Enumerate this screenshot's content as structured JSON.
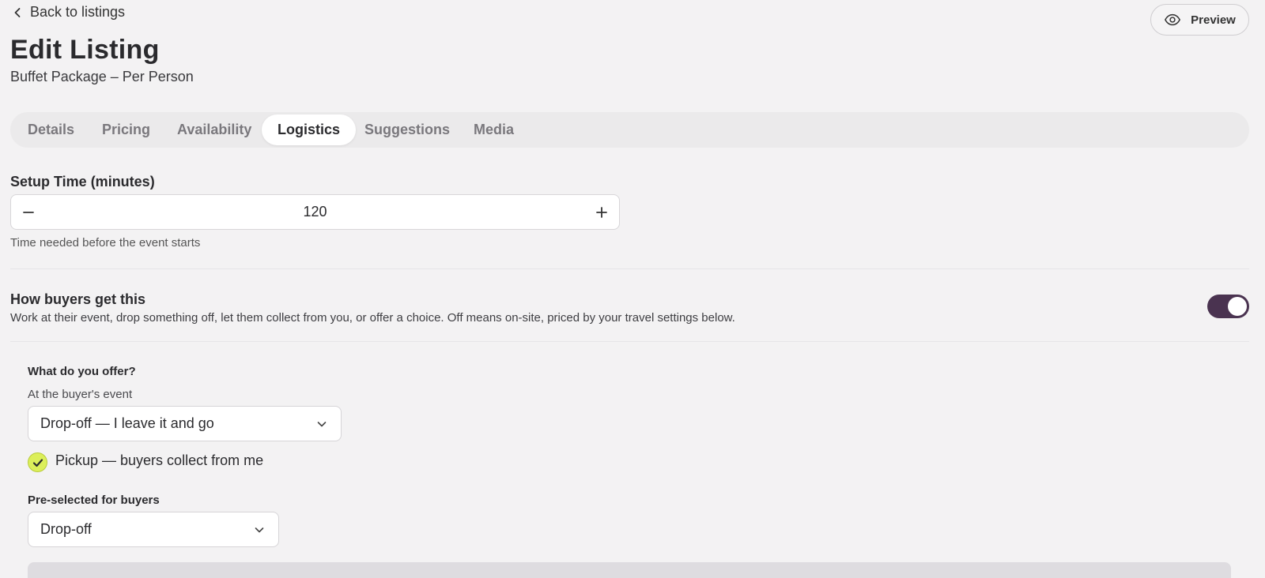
{
  "nav": {
    "back_label": "Back to listings",
    "preview_label": "Preview"
  },
  "header": {
    "title": "Edit Listing",
    "subtitle": "Buffet Package – Per Person"
  },
  "tabs": [
    {
      "label": "Details"
    },
    {
      "label": "Pricing"
    },
    {
      "label": "Availability"
    },
    {
      "label": "Logistics"
    },
    {
      "label": "Suggestions"
    },
    {
      "label": "Media"
    }
  ],
  "active_tab": "Logistics",
  "setup_time": {
    "label": "Setup Time (minutes)",
    "value": "120",
    "help": "Time needed before the event starts"
  },
  "delivery": {
    "title": "How buyers get this",
    "description": "Work at their event, drop something off, let them collect from you, or offer a choice. Off means on-site, priced by your travel settings below.",
    "toggle_on": true,
    "offer_label": "What do you offer?",
    "event_sublabel": "At the buyer's event",
    "event_option": "Drop-off — I leave it and go",
    "pickup_label": "Pickup — buyers collect from me",
    "pickup_checked": true,
    "preselect_label": "Pre-selected for buyers",
    "preselect_value": "Drop-off"
  },
  "colors": {
    "accent": "#4a3350",
    "check": "#dcef5a",
    "background": "#f3f2f3"
  },
  "icons": {
    "back": "chevron-left-icon",
    "preview": "eye-icon",
    "minus": "minus-icon",
    "plus": "plus-icon",
    "dropdown": "chevron-down-icon",
    "check": "check-icon"
  }
}
